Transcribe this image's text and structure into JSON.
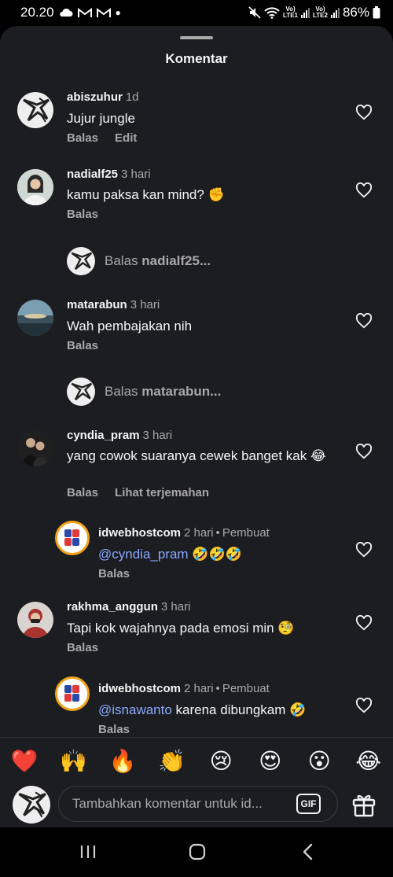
{
  "status_bar": {
    "time": "20.20",
    "net1": "Vo)\nLTE1",
    "net2": "Vo)\nLTE2",
    "battery": "86%"
  },
  "sheet": {
    "title": "Komentar"
  },
  "comments": [
    {
      "username": "abiszuhur",
      "time": "1d",
      "text": "Jujur jungle",
      "actions": [
        "Balas",
        "Edit"
      ]
    },
    {
      "username": "nadialf25",
      "time": "3 hari",
      "text": "kamu paksa kan mind? ✊",
      "actions": [
        "Balas"
      ]
    },
    {
      "username": "matarabun",
      "time": "3 hari",
      "text": "Wah pembajakan nih",
      "actions": [
        "Balas"
      ]
    },
    {
      "username": "cyndia_pram",
      "time": "3 hari",
      "text": "yang cowok suaranya cewek banget kak 😂",
      "actions": [
        "Balas",
        "Lihat terjemahan"
      ]
    },
    {
      "username": "idwebhostcom",
      "time": "2 hari",
      "creator": "Pembuat",
      "mention": "@cyndia_pram",
      "text": " 🤣🤣🤣",
      "actions": [
        "Balas"
      ]
    },
    {
      "username": "rakhma_anggun",
      "time": "3 hari",
      "text": "Tapi kok wajahnya pada emosi min 🧐",
      "actions": [
        "Balas"
      ]
    },
    {
      "username": "idwebhostcom",
      "time": "2 hari",
      "creator": "Pembuat",
      "mention": "@isnawanto",
      "text": " karena dibungkam 🤣",
      "actions": [
        "Balas"
      ]
    }
  ],
  "reply_prompts": [
    {
      "prefix": "Balas",
      "target": "nadialf25..."
    },
    {
      "prefix": "Balas",
      "target": "matarabun..."
    }
  ],
  "emoji_reactions": [
    "❤️",
    "🙌",
    "🔥",
    "👏",
    "😢",
    "😍",
    "😮",
    "😂"
  ],
  "input": {
    "placeholder": "Tambahkan komentar untuk id...",
    "gif_label": "GIF"
  },
  "colors": {
    "background": "#1b1d20",
    "secondary_text": "#a8a8a8",
    "mention": "#8aa8ff"
  }
}
